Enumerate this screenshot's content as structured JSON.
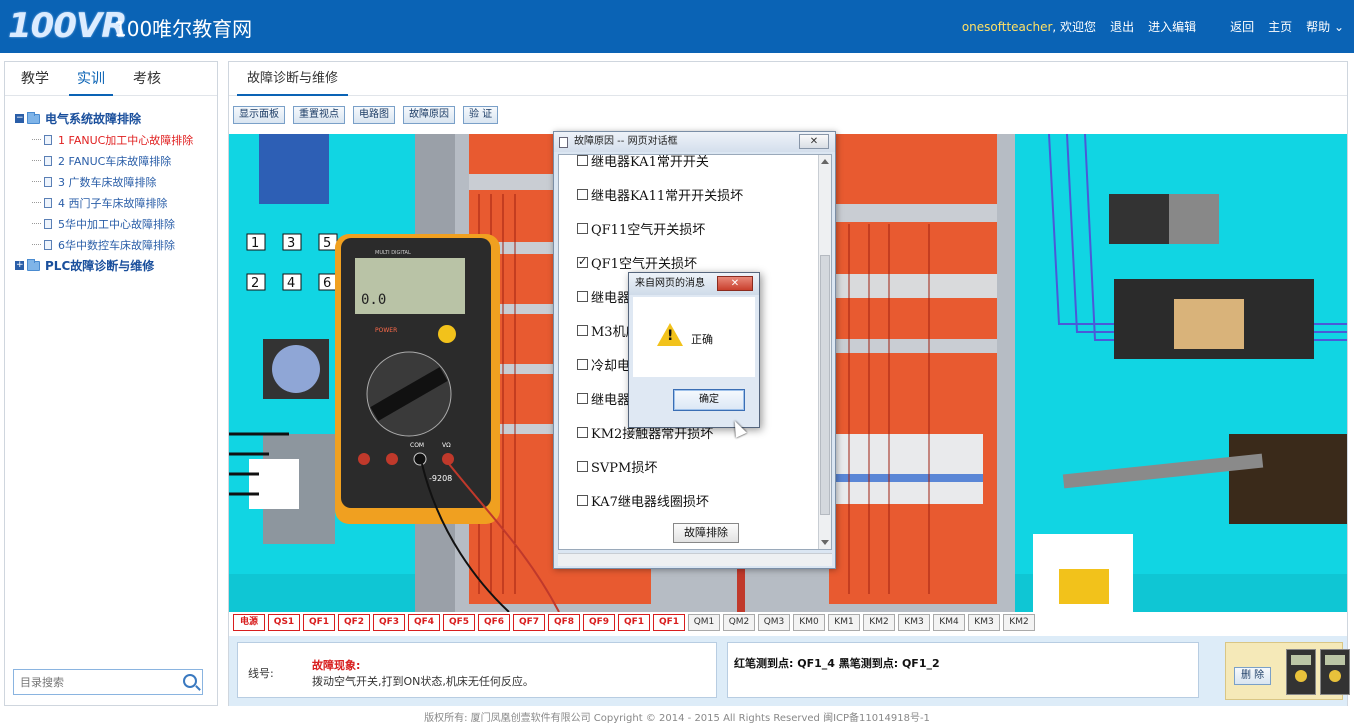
{
  "header": {
    "logo_text": "100VR",
    "site_title": "100唯尔教育网",
    "user": "onesoftteacher",
    "welcome": ", 欢迎您",
    "logout": "退出",
    "edit": "进入编辑",
    "back": "返回",
    "home": "主页",
    "help": "帮助 ⌄"
  },
  "sidebar": {
    "tabs": [
      {
        "label": "教学",
        "active": false
      },
      {
        "label": "实训",
        "active": true
      },
      {
        "label": "考核",
        "active": false
      }
    ],
    "tree": {
      "root1": "电气系统故障排除",
      "children": [
        "1 FANUC加工中心故障排除",
        "2 FANUC车床故障排除",
        "3 广数车床故障排除",
        "4 西门子车床故障排除",
        "5华中加工中心故障排除",
        "6华中数控车床故障排除"
      ],
      "root2": "PLC故障诊断与维修"
    },
    "search_placeholder": "目录搜索"
  },
  "main": {
    "tab": "故障诊断与维修",
    "toolbar": [
      "显示面板",
      "重置视点",
      "电路图",
      "故障原因",
      "验 证"
    ],
    "multimeter": {
      "display": "0.0",
      "brand": "MULTI DIGITAL",
      "label": "POWER",
      "model": "-9208",
      "com": "COM",
      "vo": "VΩ"
    },
    "buttons_panel": [
      "1",
      "3",
      "5",
      "2",
      "4",
      "6"
    ],
    "components": [
      {
        "label": "电源",
        "state": "red"
      },
      {
        "label": "QS1",
        "state": "red"
      },
      {
        "label": "QF1",
        "state": "red"
      },
      {
        "label": "QF2",
        "state": "red"
      },
      {
        "label": "QF3",
        "state": "red"
      },
      {
        "label": "QF4",
        "state": "red"
      },
      {
        "label": "QF5",
        "state": "red"
      },
      {
        "label": "QF6",
        "state": "red"
      },
      {
        "label": "QF7",
        "state": "red"
      },
      {
        "label": "QF8",
        "state": "red"
      },
      {
        "label": "QF9",
        "state": "red"
      },
      {
        "label": "QF1",
        "state": "red"
      },
      {
        "label": "QF1",
        "state": "red"
      },
      {
        "label": "QM1",
        "state": "gray"
      },
      {
        "label": "QM2",
        "state": "gray"
      },
      {
        "label": "QM3",
        "state": "gray"
      },
      {
        "label": "KM0",
        "state": "gray"
      },
      {
        "label": "KM1",
        "state": "gray"
      },
      {
        "label": "KM2",
        "state": "gray"
      },
      {
        "label": "KM3",
        "state": "gray"
      },
      {
        "label": "KM4",
        "state": "gray"
      },
      {
        "label": "KM3",
        "state": "gray"
      },
      {
        "label": "KM2",
        "state": "gray"
      }
    ],
    "info": {
      "wire_label": "线号:",
      "phenomenon_title": "故障现象:",
      "phenomenon_text": "拨动空气开关,打到ON状态,机床无任何反应。",
      "probe_text": "红笔测到点: QF1_4 黑笔测到点: QF1_2",
      "delete": "删 除"
    }
  },
  "fault_dialog": {
    "title": "故障原因 -- 网页对话框",
    "close": "✕",
    "items": [
      {
        "label": "继电器KA1常开开关",
        "checked": false
      },
      {
        "label": "继电器KA11常开开关损坏",
        "checked": false
      },
      {
        "label": "QF11空气开关损坏",
        "checked": false
      },
      {
        "label": "QF1空气开关损坏",
        "checked": true
      },
      {
        "label": "继电器",
        "checked": false
      },
      {
        "label": "M3机床",
        "checked": false
      },
      {
        "label": "冷却电",
        "checked": false
      },
      {
        "label": "继电器",
        "checked": false
      },
      {
        "label": "KM2接触器常开损坏",
        "checked": false
      },
      {
        "label": "SVPM损坏",
        "checked": false
      },
      {
        "label": "KA7继电器线圈损坏",
        "checked": false
      }
    ],
    "submit": "故障排除"
  },
  "alert": {
    "title": "来自网页的消息",
    "close": "✕",
    "message": "正确",
    "ok": "确定"
  },
  "footer": "版权所有: 厦门凤凰创壹软件有限公司    Copyright © 2014 - 2015    All Rights Reserved    闽ICP备11014918号-1",
  "colors": {
    "header_bg": "#0a63b5",
    "scene_bg": "#11d5e3",
    "cabinet_orange": "#e85a30",
    "accent_red": "#d81e1e"
  }
}
